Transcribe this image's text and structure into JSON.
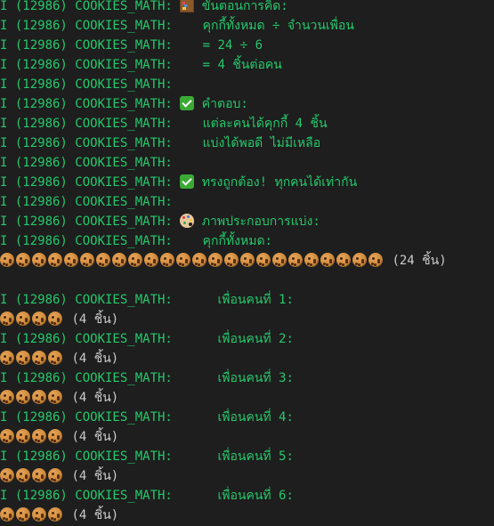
{
  "log_prefix": "I (12986) COOKIES_MATH:",
  "lines": [
    {
      "type": "log",
      "icon": "abacus-icon",
      "text": "ขั้นตอนการคิด:"
    },
    {
      "type": "log",
      "icon": "",
      "text": "คุกกี้ทั้งหมด ÷ จำนวนเพื่อน"
    },
    {
      "type": "log",
      "icon": "",
      "text": "= 24 ÷ 6"
    },
    {
      "type": "log",
      "icon": "",
      "text": "= 4 ชิ้นต่อคน"
    },
    {
      "type": "log",
      "icon": "",
      "text": ""
    },
    {
      "type": "log",
      "icon": "check-icon",
      "text": "คำตอบ:"
    },
    {
      "type": "log",
      "icon": "",
      "text": "แต่ละคนได้คุกกี้ 4 ชิ้น"
    },
    {
      "type": "log",
      "icon": "",
      "text": "แบ่งได้พอดี ไม่มีเหลือ"
    },
    {
      "type": "log",
      "icon": "",
      "text": ""
    },
    {
      "type": "log",
      "icon": "check-icon",
      "text": "ทรงถูกต้อง! ทุกคนได้เท่ากัน"
    },
    {
      "type": "log",
      "icon": "",
      "text": ""
    },
    {
      "type": "log",
      "icon": "palette-icon",
      "text": "ภาพประกอบการแบ่ง:"
    },
    {
      "type": "log",
      "icon": "",
      "text": "คุกกี้ทั้งหมด:"
    },
    {
      "type": "cookies",
      "count": 24,
      "label": "(24 ชิ้น)"
    },
    {
      "type": "blank"
    },
    {
      "type": "log",
      "icon": "",
      "text": "  เพื่อนคนที่ 1:"
    },
    {
      "type": "cookies",
      "count": 4,
      "label": "(4 ชิ้น)"
    },
    {
      "type": "log",
      "icon": "",
      "text": "  เพื่อนคนที่ 2:"
    },
    {
      "type": "cookies",
      "count": 4,
      "label": "(4 ชิ้น)"
    },
    {
      "type": "log",
      "icon": "",
      "text": "  เพื่อนคนที่ 3:"
    },
    {
      "type": "cookies",
      "count": 4,
      "label": "(4 ชิ้น)"
    },
    {
      "type": "log",
      "icon": "",
      "text": "  เพื่อนคนที่ 4:"
    },
    {
      "type": "cookies",
      "count": 4,
      "label": "(4 ชิ้น)"
    },
    {
      "type": "log",
      "icon": "",
      "text": "  เพื่อนคนที่ 5:"
    },
    {
      "type": "cookies",
      "count": 4,
      "label": "(4 ชิ้น)"
    },
    {
      "type": "log",
      "icon": "",
      "text": "  เพื่อนคนที่ 6:"
    },
    {
      "type": "cookies",
      "count": 4,
      "label": "(4 ชิ้น)"
    }
  ],
  "colors": {
    "background": "#1e1e1e",
    "log_text": "#24c96b",
    "plain_text": "#cccccc"
  }
}
